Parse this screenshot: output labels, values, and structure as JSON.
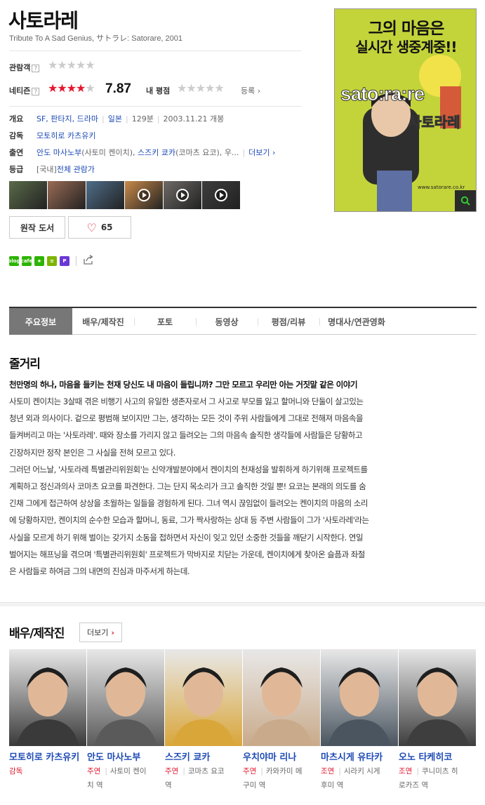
{
  "movie": {
    "title": "사토라레",
    "subtitle": "Tribute To A Sad Genius, サトラレ: Satorare, 2001"
  },
  "ratings": {
    "audience_label": "관람객",
    "audience_stars": 0,
    "netizen_label": "네티즌",
    "netizen_stars": 4,
    "netizen_score": "7.87",
    "my_rating_label": "내 평점",
    "my_stars": 0,
    "register_label": "등록",
    "help_mark": "?"
  },
  "info": {
    "overview_label": "개요",
    "genre": "SF, 판타지, 드라마",
    "country": "일본",
    "runtime": "129분",
    "release": "2003.11.21 개봉",
    "director_label": "감독",
    "director": "모토히로 카츠유키",
    "cast_label": "출연",
    "cast_1": "안도 마사노부",
    "cast_1_role": "(사토미 켄이치),",
    "cast_2": "스즈키 쿄카",
    "cast_2_role": "(코마츠 요코),",
    "cast_more_text": "우...",
    "more_label": "더보기",
    "grade_label": "등급",
    "grade_prefix": "[국내]",
    "grade": "전체 관람가"
  },
  "thumbnails": [
    {
      "color": "#5a6b4a",
      "video": false
    },
    {
      "color": "#9a6b55",
      "video": false
    },
    {
      "color": "#4f6e8a",
      "video": false
    },
    {
      "color": "#c98a4a",
      "video": true
    },
    {
      "color": "#6e6a66",
      "video": true
    },
    {
      "color": "#3d3d3d",
      "video": true
    }
  ],
  "buttons": {
    "original_book": "원작 도서",
    "like_count": "65"
  },
  "share_icons": [
    {
      "name": "blog-icon",
      "color": "#2db400",
      "text": "blog"
    },
    {
      "name": "cafe-icon",
      "color": "#2db400",
      "text": "cafe"
    },
    {
      "name": "bookmark-icon",
      "color": "#2db400",
      "text": "★"
    },
    {
      "name": "memo-icon",
      "color": "#7cb500",
      "text": "≡"
    },
    {
      "name": "calendar-icon",
      "color": "#6b37d6",
      "text": "P"
    }
  ],
  "poster": {
    "headline_line1": "그의 마음은",
    "headline_line2": "실시간 생중계중!!",
    "brand": "sato:ra:re",
    "korean_title": "사토라레",
    "url": "www.satorare.co.kr"
  },
  "tabs": [
    {
      "label": "주요정보",
      "active": true,
      "width": 90
    },
    {
      "label": "배우/제작진",
      "active": false,
      "width": 88
    },
    {
      "label": "포토",
      "active": false,
      "width": 88
    },
    {
      "label": "동영상",
      "active": false,
      "width": 88
    },
    {
      "label": "평점/리뷰",
      "active": false,
      "width": 88
    },
    {
      "label": "명대사/연관영화",
      "active": false,
      "width": 106
    }
  ],
  "plot": {
    "heading": "줄거리",
    "tagline": "천만명의 하나, 마음을 들키는 천재 당신도 내 마음이 들립니까? 그만 모르고 우리만 아는 거짓말 같은 이야기",
    "lines": [
      "사토미 켄이치는 3살때 겪은 비행기 사고의 유일한 생존자로서 그 사고로 부모를 잃고 할머니와 단둘이 살고있는",
      "청년 외과 의사이다. 겉으로 평범해 보이지만 그는, 생각하는 모든 것이 주위 사람들에게 그대로 전해져 마음속을",
      "들켜버리고 마는 '사토라레'. 때와 장소를 가리지 않고 들려오는 그의 마음속 솔직한 생각들에 사람들은 당황하고",
      "긴장하지만 정작 본인은 그 사실을 전혀 모르고 있다.",
      " 그러던 어느날, '사토라레 특별관리위원회'는 신약개발분야에서 켄이치의 천재성을 발휘하게 하기위해 프로젝트를",
      "계획하고 정신과의사 코마츠 요코를 파견한다. 그는 단지 목소리가 크고 솔직한 것일 뿐! 요코는 본래의 의도를 숨",
      "긴채 그에게 접근하여 상상을 초월하는 일들을 경험하게 된다. 그녀 역시 끊임없이 들려오는 켄이치의 마음의 소리",
      "에 당황하지만, 켄이치의 순수한 모습과 할머니, 동료, 그가 짝사랑하는 상대 등 주변 사람들이 그가 '사토라레'라는",
      "사실을 모르게 하기 위해 벌이는 갖가지 소동을 접하면서 자신이 잊고 있던 소중한 것들을 깨닫기 시작한다. 연일",
      "벌어지는 해프닝을 겪으며 '특별관리위원회' 프로젝트가 막바지로 치닫는 가운데, 켄이치에게 찾아온 슬픔과 좌절",
      "은 사람들로 하여금 그의 내면의 진심과 마주서게 하는데."
    ]
  },
  "crew": {
    "heading": "배우/제작진",
    "more_label": "더보기",
    "people": [
      {
        "name": "모토히로 카츠유키",
        "kind": "감독",
        "role_line1": "",
        "role_line2": "",
        "bg": "#3a3a3a"
      },
      {
        "name": "안도 마사노부",
        "kind": "주연",
        "role_line1": "사토미 켄이",
        "role_line2": "치 역",
        "bg": "#5a5a5a"
      },
      {
        "name": "스즈키 쿄카",
        "kind": "주연",
        "role_line1": "코마츠 요코",
        "role_line2": "역",
        "bg": "#d9a63a"
      },
      {
        "name": "우치야마 리나",
        "kind": "주연",
        "role_line1": "카와카미 메",
        "role_line2": "구미 역",
        "bg": "#c9aa8a"
      },
      {
        "name": "마츠시게 유타카",
        "kind": "조연",
        "role_line1": "시라키 시게",
        "role_line2": "후미 역",
        "bg": "#4a5560"
      },
      {
        "name": "오노 타케히코",
        "kind": "조연",
        "role_line1": "쿠니미츠 히",
        "role_line2": "로카즈 역",
        "bg": "#3e3e3e"
      }
    ]
  }
}
